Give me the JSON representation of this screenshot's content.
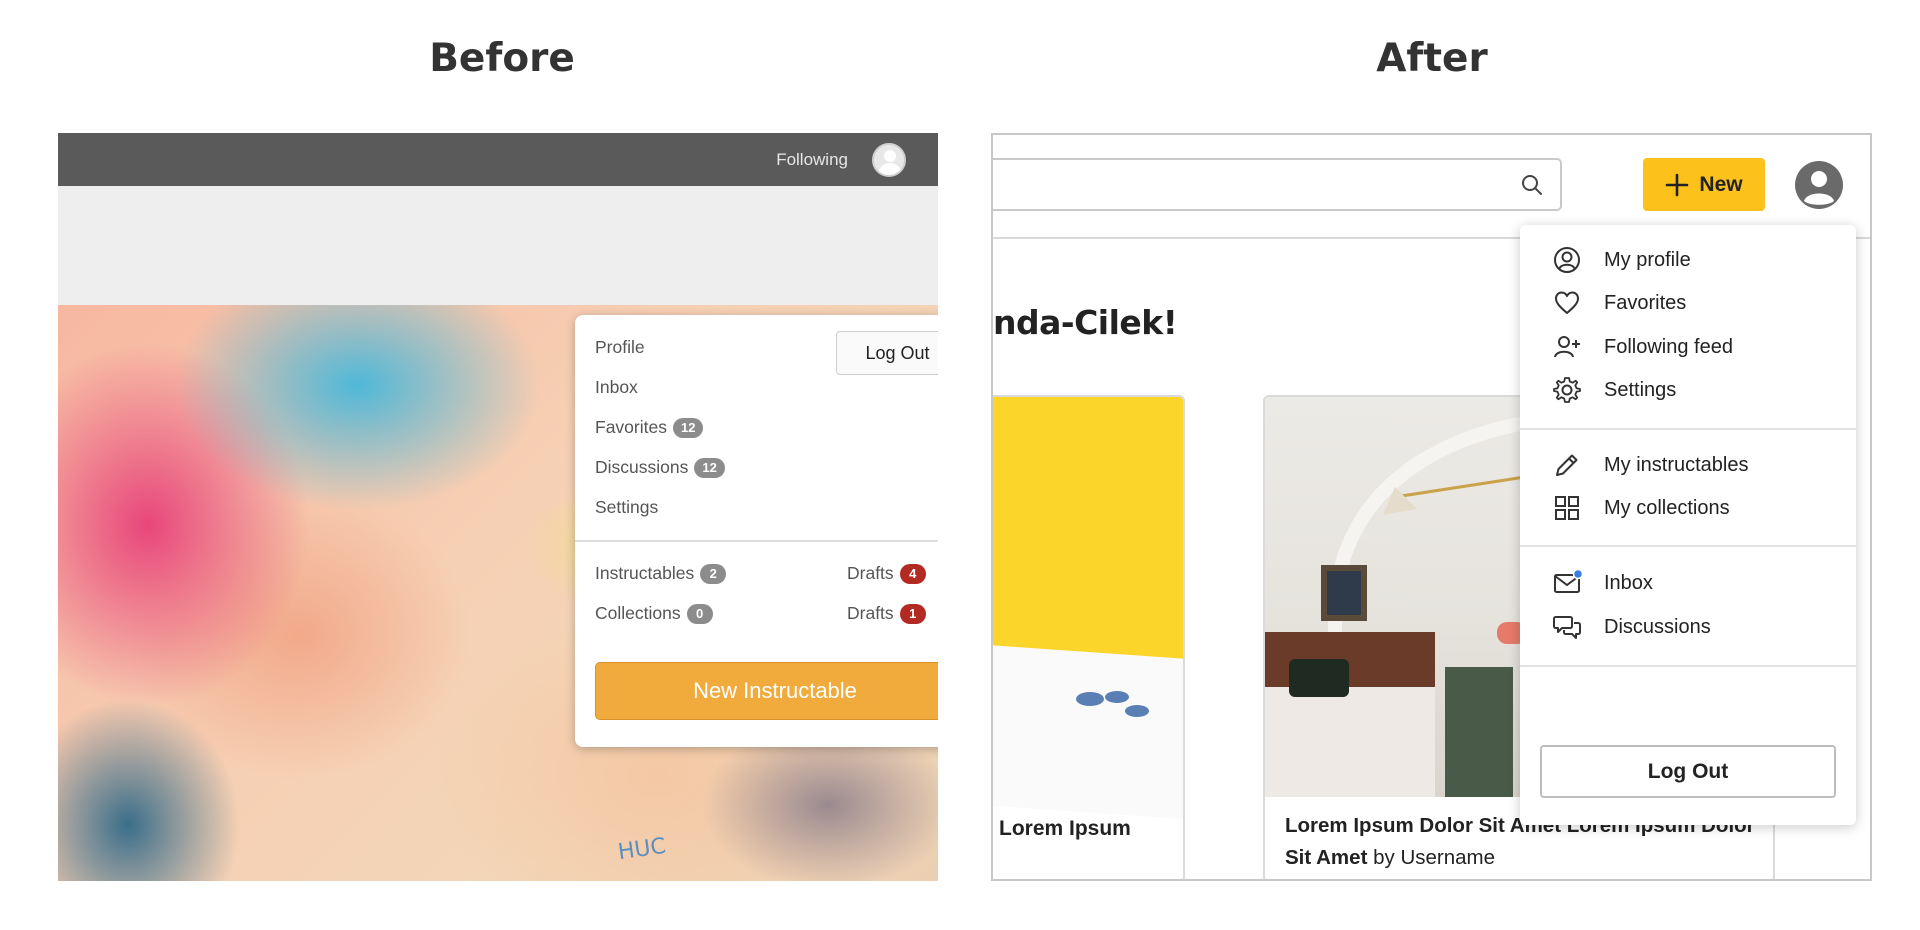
{
  "headings": {
    "before": "Before",
    "after": "After"
  },
  "before": {
    "topbar": {
      "following_label": "Following"
    },
    "menu": {
      "profile": "Profile",
      "inbox": "Inbox",
      "favorites": {
        "label": "Favorites",
        "count": "12"
      },
      "discussions": {
        "label": "Discussions",
        "count": "12"
      },
      "settings": "Settings",
      "logout": "Log Out",
      "instructables": {
        "label": "Instructables",
        "count": "2"
      },
      "collections": {
        "label": "Collections",
        "count": "0"
      },
      "drafts_1": {
        "label": "Drafts",
        "count": "4"
      },
      "drafts_2": {
        "label": "Drafts",
        "count": "1"
      },
      "new_instructable": "New Instructable"
    },
    "photo_text": "HUC"
  },
  "after": {
    "header": {
      "search_placeholder": "",
      "new_button": "New"
    },
    "greeting": "nda-Cilek!",
    "cards": [
      {
        "title": "Lorem Ipsum"
      },
      {
        "title": "Lorem Ipsum Dolor Sit Amet Lorem Ipsum Dolor Sit Amet",
        "by": "by",
        "author": "Username"
      }
    ],
    "menu": {
      "my_profile": "My profile",
      "favorites": "Favorites",
      "following_feed": "Following feed",
      "settings": "Settings",
      "my_instructables": "My instructables",
      "my_collections": "My collections",
      "inbox": "Inbox",
      "discussions": "Discussions",
      "logout": "Log Out"
    }
  },
  "colors": {
    "before_accent": "#f1ab3c",
    "after_accent": "#fcc21b",
    "badge_red": "#b22a22",
    "notification_dot": "#3b7de0"
  }
}
